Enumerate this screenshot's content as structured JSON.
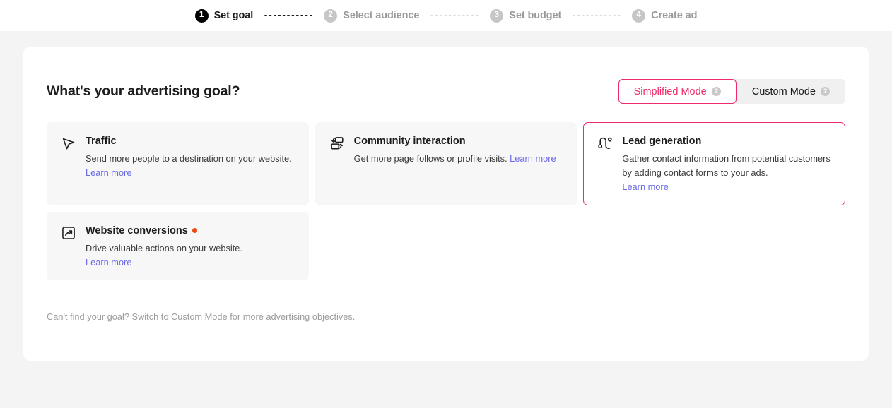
{
  "stepper": {
    "steps": [
      {
        "number": "1",
        "label": "Set goal",
        "state": "active"
      },
      {
        "number": "2",
        "label": "Select audience",
        "state": "inactive"
      },
      {
        "number": "3",
        "label": "Set budget",
        "state": "inactive"
      },
      {
        "number": "4",
        "label": "Create ad",
        "state": "inactive"
      }
    ]
  },
  "panel": {
    "title": "What's your advertising goal?",
    "mode_toggle": {
      "selected": "Simplified Mode",
      "options": [
        {
          "label": "Simplified Mode",
          "help": "?",
          "selected": true
        },
        {
          "label": "Custom Mode",
          "help": "?",
          "selected": false
        }
      ]
    },
    "goals": [
      {
        "id": "traffic",
        "icon": "cursor-arrow-icon",
        "name": "Traffic",
        "desc": "Send more people to a destination on your website.",
        "learn_more": "Learn more",
        "learn_more_inline": true,
        "badge": null,
        "selected": false
      },
      {
        "id": "community-interaction",
        "icon": "community-interaction-icon",
        "name": "Community interaction",
        "desc": "Get more page follows or profile visits.",
        "learn_more": "Learn more",
        "learn_more_inline": true,
        "badge": null,
        "selected": false
      },
      {
        "id": "lead-generation",
        "icon": "lead-generation-icon",
        "name": "Lead generation",
        "desc": "Gather contact information from potential customers by adding contact forms to your ads.",
        "learn_more": "Learn more",
        "learn_more_inline": false,
        "badge": null,
        "selected": true
      },
      {
        "id": "website-conversions",
        "icon": "website-conversions-icon",
        "name": "Website conversions",
        "desc": "Drive valuable actions on your website.",
        "learn_more": "Learn more",
        "learn_more_inline": false,
        "badge": "new-dot",
        "selected": false
      }
    ],
    "footer_note": "Can't find your goal? Switch to Custom Mode for more advertising objectives."
  },
  "colors": {
    "accent": "#f02a68",
    "link": "#6a6ae8",
    "badge_dot": "#ed4812",
    "page_bg": "#f4f4f4",
    "tile_bg": "#f7f7f7"
  }
}
